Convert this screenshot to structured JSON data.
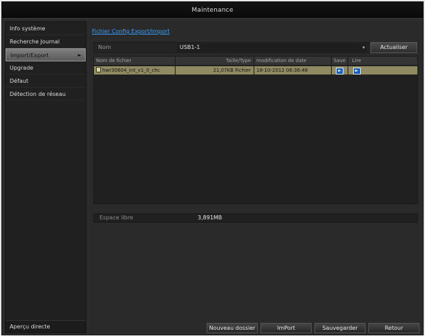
{
  "window": {
    "title": "Maintenance"
  },
  "sidebar": {
    "items": [
      {
        "label": "Info système"
      },
      {
        "label": "Recherche Journal"
      },
      {
        "label": "Import/Export",
        "arrow": "►"
      },
      {
        "label": "Upgrade"
      },
      {
        "label": "Défaut"
      },
      {
        "label": "Détection de réseau"
      }
    ],
    "active_index": 2,
    "bottom_label": "Aperçu directe"
  },
  "content": {
    "section_title": "Fichier Config Export/Import",
    "device": {
      "label": "Nom",
      "selected": "USB1-1",
      "arrow": "▾",
      "refresh_label": "Actualiser"
    },
    "table": {
      "headers": {
        "name": "Nom de fichier",
        "size": "Taille/Type",
        "date": "modification de date",
        "save": "Save",
        "read": "Lire"
      },
      "rows": [
        {
          "name": "hwr30604_int_v1_0_chc",
          "size": "21,07KB Fichier",
          "date": "18-10-2012 08:36:48",
          "save_icon": "►",
          "read_icon": "►"
        }
      ]
    },
    "free_space": {
      "label": "Espace libre",
      "value": "3,891MB"
    },
    "buttons": {
      "new_folder": "Nouveau dossier",
      "import": "ImPort",
      "save": "Sauvegarder",
      "back": "Retour"
    }
  },
  "colors": {
    "accent_link": "#3aa0ff",
    "selected_row": "#8f8a62",
    "action_icon": "#1a5fb0"
  }
}
